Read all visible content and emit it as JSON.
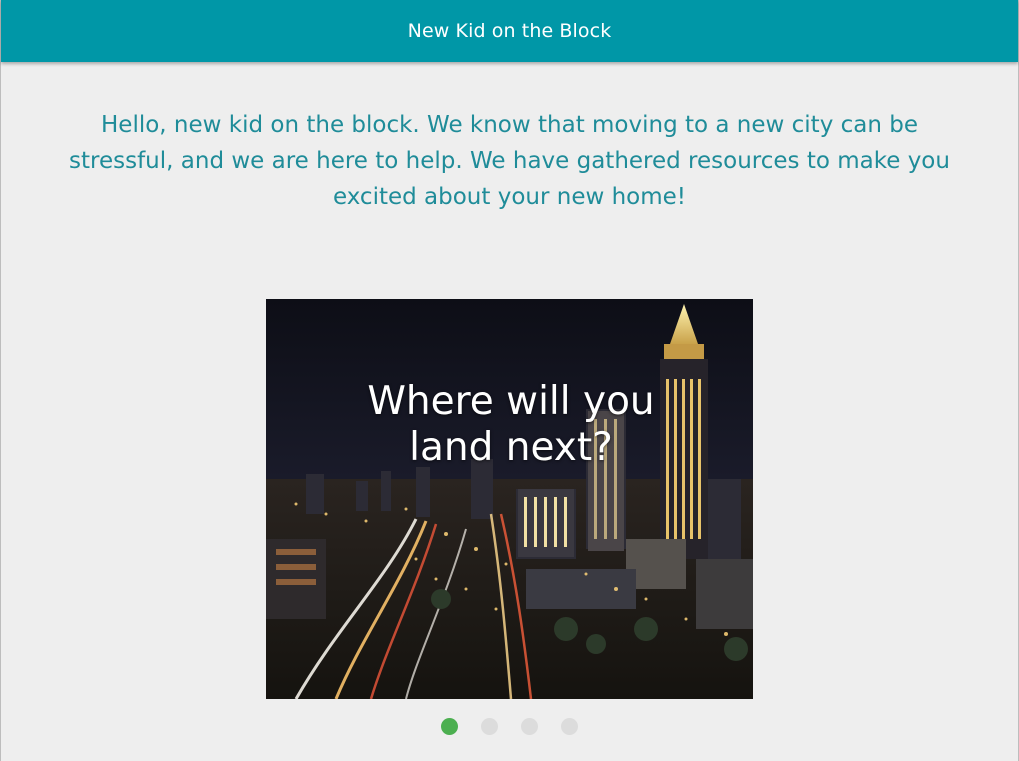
{
  "header": {
    "title": "New Kid on the Block",
    "color": "#0097a7"
  },
  "intro": {
    "text": "Hello, new kid on the block. We know that moving to a new city can be stressful, and we are here to help. We have gathered resources to make you excited about your new home!",
    "color": "#1f8c99"
  },
  "carousel": {
    "slides": [
      {
        "caption": "Where will you land next?",
        "image": "city-night-skyline"
      }
    ],
    "active_index": 0,
    "total_slides": 4,
    "indicator_active_color": "#4caf50",
    "indicator_inactive_color": "#dcdcdc"
  }
}
